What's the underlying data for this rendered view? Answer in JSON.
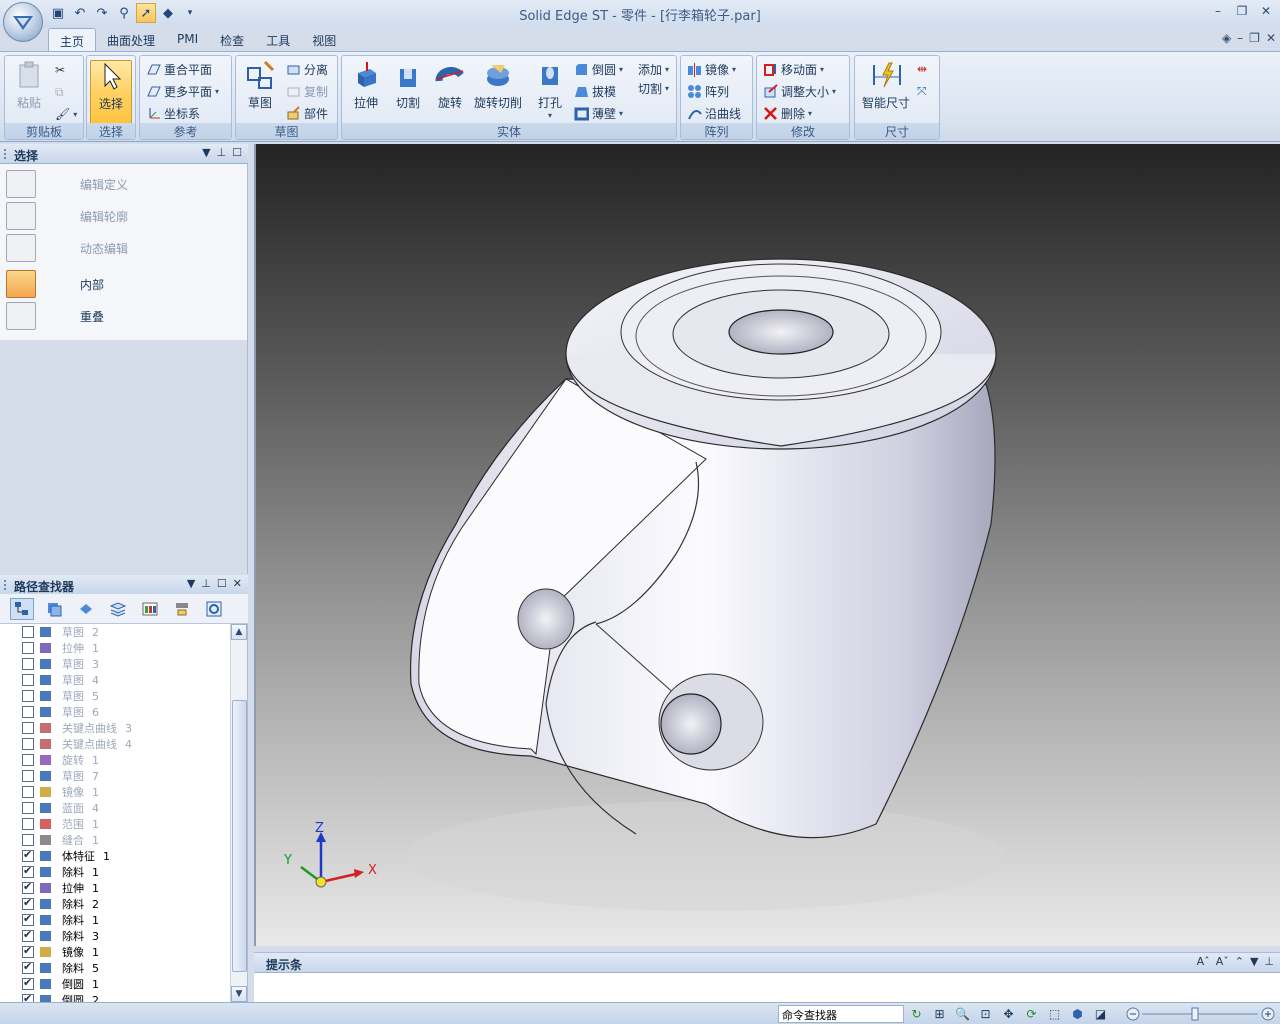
{
  "title": "Solid Edge ST - 零件 - [行李箱轮子.par]",
  "tabs": [
    "主页",
    "曲面处理",
    "PMI",
    "检查",
    "工具",
    "视图"
  ],
  "ribbon": {
    "clipboard": {
      "label": "剪贴板",
      "paste": "粘贴"
    },
    "select": {
      "label": "选择",
      "btn": "选择"
    },
    "reference": {
      "label": "参考",
      "coincident": "重合平面",
      "more": "更多平面",
      "cs": "坐标系"
    },
    "sketch": {
      "label": "草图",
      "sketch": "草图",
      "split": "分离",
      "copy": "复制",
      "part": "部件"
    },
    "solid": {
      "label": "实体",
      "extrude": "拉伸",
      "cut": "切割",
      "revolve": "旋转",
      "revcut": "旋转切削",
      "hole": "打孔",
      "round": "倒圆",
      "draft": "拔模",
      "thin": "薄壁",
      "add": "添加",
      "cut2": "切割"
    },
    "pattern": {
      "label": "阵列",
      "mirror": "镜像",
      "pattern": "阵列",
      "along": "沿曲线"
    },
    "modify": {
      "label": "修改",
      "move": "移动面",
      "resize": "调整大小",
      "delete": "删除"
    },
    "dimension": {
      "label": "尺寸",
      "smart": "智能尺寸"
    }
  },
  "select_panel": {
    "title": "选择",
    "items": [
      {
        "label": "编辑定义",
        "enabled": false
      },
      {
        "label": "编辑轮廓",
        "enabled": false
      },
      {
        "label": "动态编辑",
        "enabled": false
      },
      {
        "label": "内部",
        "enabled": true
      },
      {
        "label": "重叠",
        "enabled": true
      }
    ]
  },
  "pathfinder": {
    "title": "路径查找器",
    "items": [
      {
        "name": "草图",
        "num": "2",
        "checked": false
      },
      {
        "name": "拉伸",
        "num": "1",
        "checked": false
      },
      {
        "name": "草图",
        "num": "3",
        "checked": false
      },
      {
        "name": "草图",
        "num": "4",
        "checked": false
      },
      {
        "name": "草图",
        "num": "5",
        "checked": false
      },
      {
        "name": "草图",
        "num": "6",
        "checked": false
      },
      {
        "name": "关键点曲线",
        "num": "3",
        "checked": false
      },
      {
        "name": "关键点曲线",
        "num": "4",
        "checked": false
      },
      {
        "name": "旋转",
        "num": "1",
        "checked": false
      },
      {
        "name": "草图",
        "num": "7",
        "checked": false
      },
      {
        "name": "镜像",
        "num": "1",
        "checked": false
      },
      {
        "name": "蓝面",
        "num": "4",
        "checked": false
      },
      {
        "name": "范围",
        "num": "1",
        "checked": false
      },
      {
        "name": "缝合",
        "num": "1",
        "checked": false
      },
      {
        "name": "体特征",
        "num": "1",
        "checked": true
      },
      {
        "name": "除料",
        "num": "1",
        "checked": true
      },
      {
        "name": "拉伸",
        "num": "1",
        "checked": true
      },
      {
        "name": "除料",
        "num": "2",
        "checked": true
      },
      {
        "name": "除料",
        "num": "1",
        "checked": true
      },
      {
        "name": "除料",
        "num": "3",
        "checked": true
      },
      {
        "name": "镜像",
        "num": "1",
        "checked": true
      },
      {
        "name": "除料",
        "num": "5",
        "checked": true
      },
      {
        "name": "倒圆",
        "num": "1",
        "checked": true
      },
      {
        "name": "倒圆",
        "num": "2",
        "checked": true
      }
    ]
  },
  "prompt": {
    "title": "提示条"
  },
  "status": {
    "cmd_finder": "命令查找器"
  },
  "triad": {
    "x": "X",
    "y": "Y",
    "z": "Z"
  },
  "colors": {
    "accent": "#ffd264",
    "panel": "#dbe5f1",
    "x_axis": "#d42020",
    "y_axis": "#1e9a1e",
    "z_axis": "#1f38c9"
  }
}
